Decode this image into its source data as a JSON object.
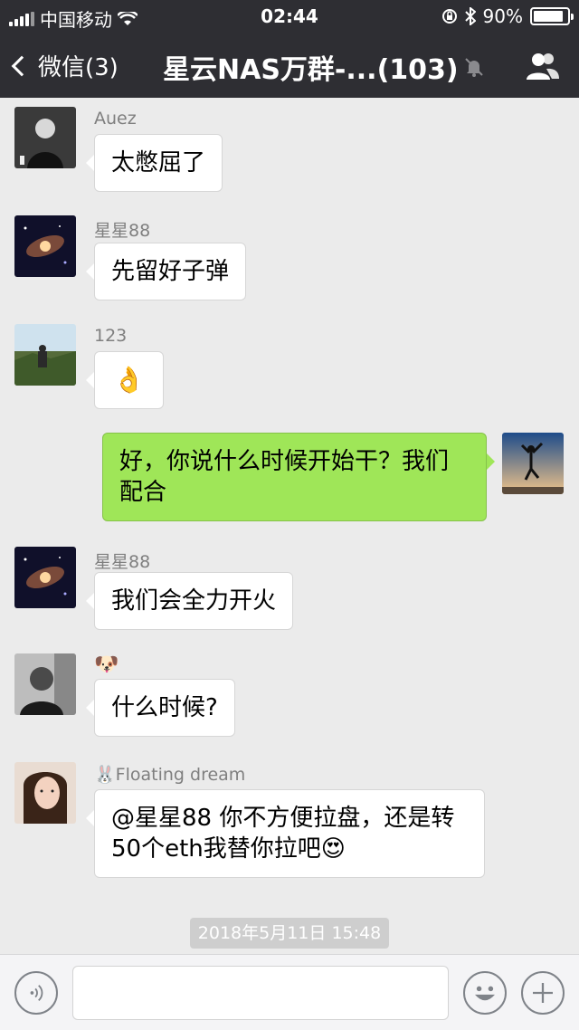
{
  "status_bar": {
    "carrier": "中国移动",
    "time": "02:44",
    "battery": "90%"
  },
  "nav": {
    "back_label": "微信(3)",
    "title": "星云NAS万群-...(103)"
  },
  "messages": [
    {
      "sender": "Auez",
      "text": "太憋屈了"
    },
    {
      "sender": "星星88",
      "text": "先留好子弹"
    },
    {
      "sender": "123",
      "text": "👌"
    },
    {
      "sender": "",
      "text": "好，你说什么时候开始干？我们配合"
    },
    {
      "sender": "星星88",
      "text": "我们会全力开火"
    },
    {
      "sender": "🐶",
      "text": "什么时候?"
    },
    {
      "sender": "🐰Floating dream",
      "text": "@星星88 你不方便拉盘，还是转50个eth我替你拉吧😍"
    }
  ],
  "timestamp": "2018年5月11日 15:48",
  "input": {
    "placeholder": ""
  },
  "colors": {
    "nav_bg": "#2e2e33",
    "sent_bubble": "#9fe658"
  }
}
